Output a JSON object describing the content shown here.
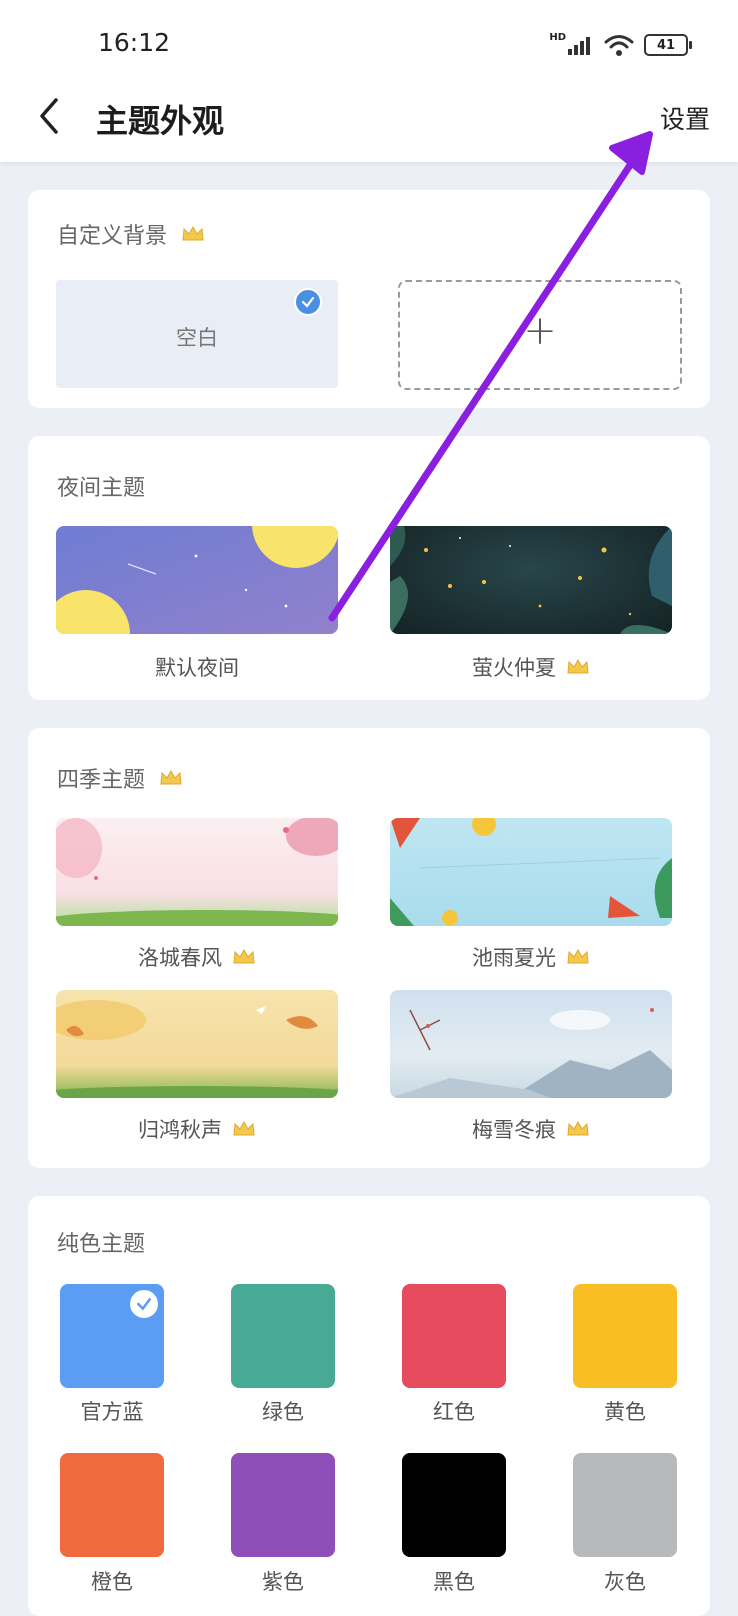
{
  "status": {
    "time": "16:12",
    "battery": "41",
    "hd": "HD"
  },
  "nav": {
    "title": "主题外观",
    "settings": "设置"
  },
  "custom_bg": {
    "title": "自定义背景",
    "blank_label": "空白",
    "add_icon": "+"
  },
  "night": {
    "title": "夜间主题",
    "items": [
      {
        "label": "默认夜间"
      },
      {
        "label": "萤火仲夏"
      }
    ]
  },
  "seasons": {
    "title": "四季主题",
    "items": [
      {
        "label": "洛城春风"
      },
      {
        "label": "池雨夏光"
      },
      {
        "label": "归鸿秋声"
      },
      {
        "label": "梅雪冬痕"
      }
    ]
  },
  "solid": {
    "title": "纯色主题",
    "items": [
      {
        "label": "官方蓝",
        "color": "#5b9cf5"
      },
      {
        "label": "绿色",
        "color": "#48aa94"
      },
      {
        "label": "红色",
        "color": "#e64a5d"
      },
      {
        "label": "黄色",
        "color": "#f9be24"
      },
      {
        "label": "橙色",
        "color": "#ef6a3c"
      },
      {
        "label": "紫色",
        "color": "#8f4fbb"
      },
      {
        "label": "黑色",
        "color": "#000000"
      },
      {
        "label": "灰色",
        "color": "#b8b9bb"
      }
    ]
  },
  "colors": {
    "accent_check": "#4a90e2",
    "annotation_arrow": "#8a1fe0",
    "crown": "#f2c94c"
  }
}
